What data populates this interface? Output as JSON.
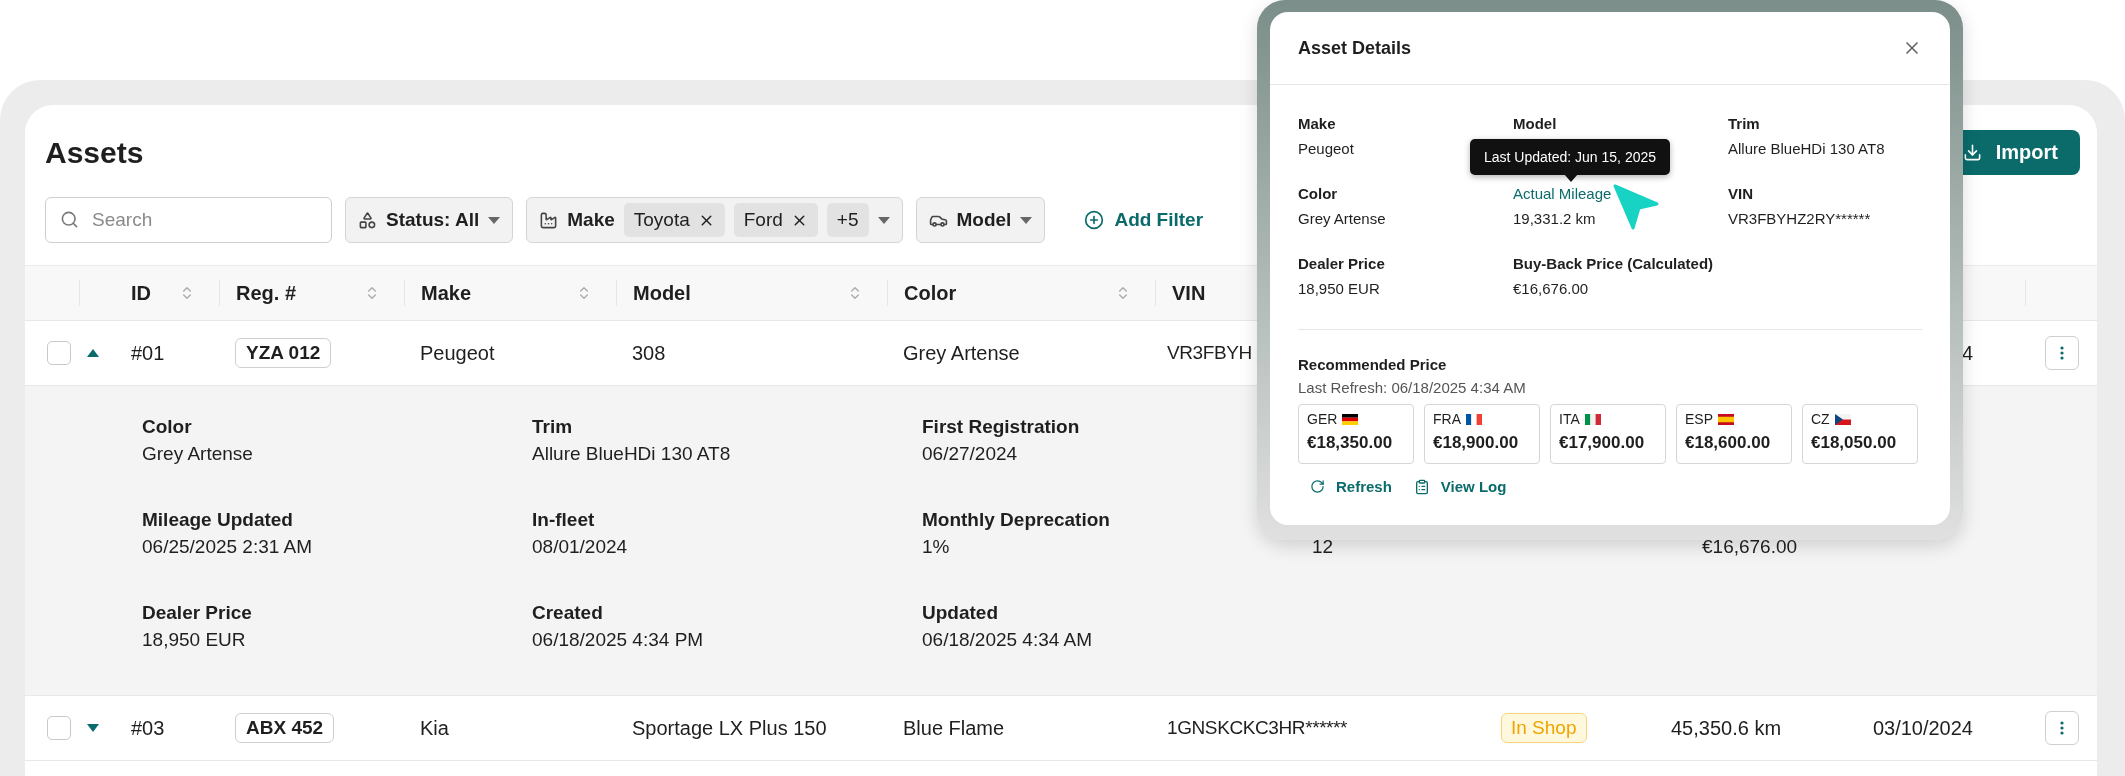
{
  "page": {
    "title": "Assets",
    "import_button": "Import"
  },
  "filters": {
    "search": {
      "placeholder": "Search"
    },
    "chips": [
      {
        "kind": "status",
        "label": "Status: All"
      },
      {
        "kind": "make",
        "label": "Make",
        "tags": [
          "Toyota",
          "Ford"
        ],
        "more": "+5"
      },
      {
        "kind": "model",
        "label": "Model"
      }
    ],
    "add_filter": "Add Filter"
  },
  "table": {
    "columns": [
      {
        "kind": "select"
      },
      {
        "kind": "expand"
      },
      {
        "kind": "data",
        "label": "ID"
      },
      {
        "kind": "data",
        "label": "Reg. #"
      },
      {
        "kind": "data",
        "label": "Make"
      },
      {
        "kind": "data",
        "label": "Model"
      },
      {
        "kind": "data",
        "label": "Color"
      },
      {
        "kind": "data",
        "label": "VIN"
      },
      {
        "kind": "data"
      },
      {
        "kind": "data"
      },
      {
        "kind": "data"
      },
      {
        "kind": "actions"
      }
    ],
    "rows": [
      {
        "checked": false,
        "expanded": true,
        "id": "#01",
        "reg": "YZA 012",
        "make": "Peugeot",
        "model": "308",
        "exterior": "Grey Artense",
        "vin": "VR3FBYH",
        "date": "4",
        "details": [
          [
            {
              "label": "Color",
              "value": "Grey Artense"
            },
            {
              "label": "Trim",
              "value": "Allure BlueHDi 130 AT8"
            },
            {
              "label": "First Registration",
              "value": "06/27/2024"
            }
          ],
          [
            {
              "label": "Mileage Updated",
              "value": "06/25/2025 2:31 AM"
            },
            {
              "label": "In-fleet",
              "value": "08/01/2024"
            },
            {
              "label": "Monthly Deprecation",
              "value": "1%"
            },
            {
              "value": "12"
            },
            {
              "value": "€16,676.00"
            }
          ],
          [
            {
              "label": "Dealer Price",
              "value": "18,950 EUR"
            },
            {
              "label": "Created",
              "value": "06/18/2025 4:34 PM"
            },
            {
              "label": "Updated",
              "value": "06/18/2025 4:34 AM"
            }
          ]
        ]
      },
      {
        "checked": false,
        "expanded": false,
        "id": "#03",
        "reg": "ABX 452",
        "make": "Kia",
        "model": "Sportage LX Plus 150",
        "exterior": "Blue Flame",
        "vin": "1GNSKCKC3HR******",
        "status": "In Shop",
        "mileage": "45,350.6 km",
        "date": "03/10/2024"
      }
    ]
  },
  "dialog": {
    "title": "Asset Details",
    "fields": [
      {
        "kind": "plain",
        "label": "Make",
        "value": "Peugeot"
      },
      {
        "kind": "plain",
        "label": "Model"
      },
      {
        "kind": "plain",
        "label": "Trim",
        "value": "Allure BlueHDi 130 AT8"
      },
      {
        "kind": "plain",
        "label": "Color",
        "value": "Grey Artense"
      },
      {
        "kind": "link",
        "label": "Actual Mileage",
        "value": "19,331.2 km",
        "tooltip": "Last Updated: Jun 15, 2025"
      },
      {
        "kind": "plain",
        "label": "VIN",
        "value": "VR3FBYHZ2RY******"
      },
      {
        "kind": "plain",
        "label": "Dealer Price",
        "value": "18,950 EUR"
      },
      {
        "kind": "plain",
        "label": "Buy-Back Price (Calculated)",
        "value": "€16,676.00"
      }
    ],
    "recommended": {
      "title": "Recommended Price",
      "last_refresh": "Last Refresh: 06/18/2025 4:34 AM",
      "prices": [
        {
          "code": "GER",
          "kind": "de",
          "price": "€18,350.00"
        },
        {
          "code": "FRA",
          "kind": "fr",
          "price": "€18,900.00"
        },
        {
          "code": "ITA",
          "kind": "it",
          "price": "€17,900.00"
        },
        {
          "code": "ESP",
          "kind": "es",
          "price": "€18,600.00"
        },
        {
          "code": "CZ",
          "kind": "cz",
          "price": "€18,050.00"
        }
      ],
      "actions": [
        {
          "kind": "refresh",
          "label": "Refresh"
        },
        {
          "kind": "log",
          "label": "View Log"
        }
      ]
    }
  }
}
